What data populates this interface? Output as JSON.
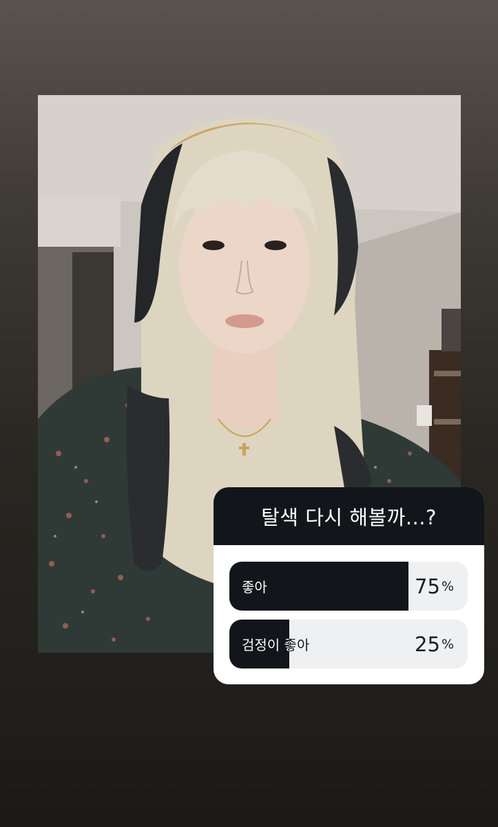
{
  "poll": {
    "question": "탈색 다시 해볼까...?",
    "options": [
      {
        "label": "좋아",
        "percent_value": "75",
        "percent_sign": "%",
        "fraction": 0.75
      },
      {
        "label": "검정이 좋아",
        "percent_value": "25",
        "percent_sign": "%",
        "fraction": 0.25
      }
    ]
  },
  "colors": {
    "poll_dark": "#12161a",
    "poll_track": "#eef0f2",
    "background_top": "#5a5450",
    "background_bottom": "#1c1a17"
  }
}
